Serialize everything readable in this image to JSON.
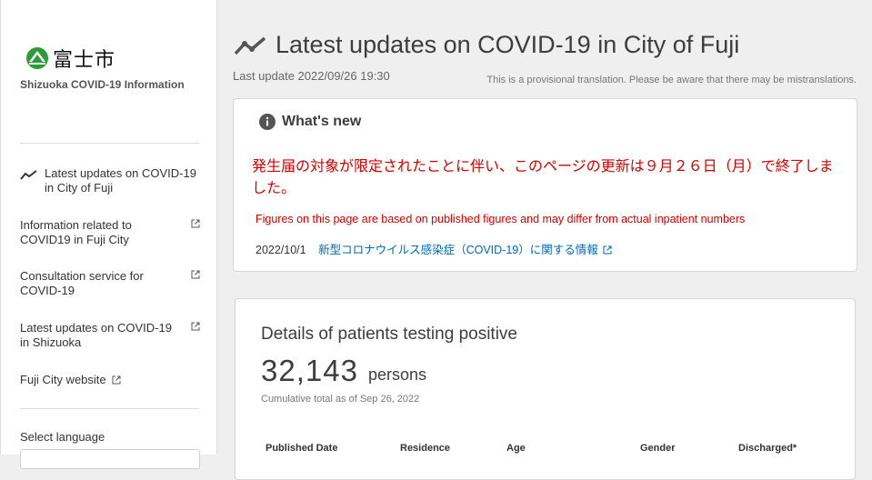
{
  "sidebar": {
    "logo_text": "富士市",
    "subtitle": "Shizuoka COVID-19 Information",
    "nav": [
      {
        "label": "Latest updates on COVID-19 in City of Fuji",
        "icon": "trend-line-icon",
        "active": true
      },
      {
        "label": "Information related to COVID19 in Fuji City",
        "icon": "external-link-icon"
      },
      {
        "label": "Consultation service for COVID-19",
        "icon": "external-link-icon"
      },
      {
        "label": "Latest updates on COVID-19 in Shizuoka",
        "icon": "external-link-icon"
      },
      {
        "label": "Fuji City website",
        "icon": "external-link-icon"
      }
    ],
    "language_label": "Select language"
  },
  "header": {
    "title": "Latest updates on COVID-19 in City of Fuji",
    "last_update": "Last update 2022/09/26 19:30",
    "translation_notice": "This is a provisional translation. Please be aware that there may be mistranslations."
  },
  "whats_new": {
    "title": "What's new",
    "notice_jp": "発生届の対象が限定されたことに伴い、このページの更新は９月２６日（月）で終了しました。",
    "notice_en": "Figures on this page are based on published figures and may differ from actual inpatient numbers",
    "items": [
      {
        "date": "2022/10/1",
        "text": "新型コロナウイルス感染症（COVID-19）に関する情報"
      }
    ]
  },
  "details": {
    "title": "Details of patients testing positive",
    "total": "32,143",
    "unit": "persons",
    "caption": "Cumulative total as of Sep 26, 2022",
    "columns": [
      "Published Date",
      "Residence",
      "Age",
      "Gender",
      "Discharged*"
    ]
  },
  "colors": {
    "accent_red": "#d50000",
    "link_blue": "#0068b6",
    "logo_green": "#2e9b3a"
  }
}
